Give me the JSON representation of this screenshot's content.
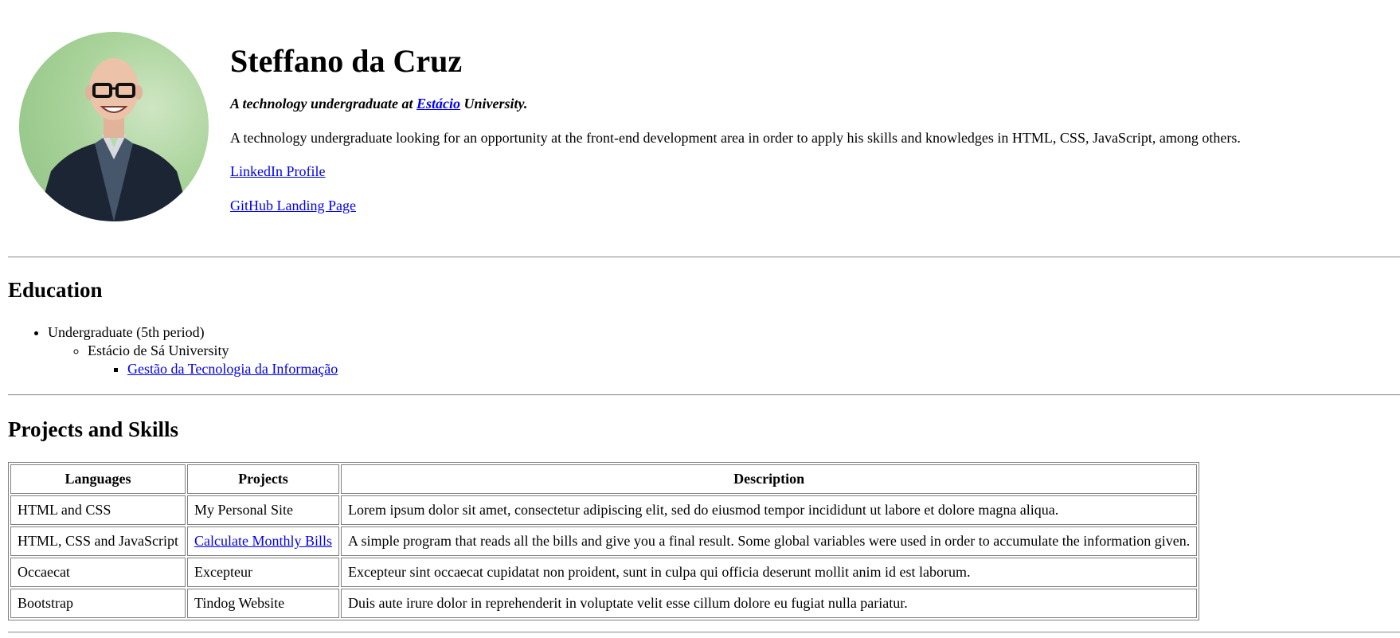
{
  "header": {
    "name": "Steffano da Cruz",
    "tagline_prefix": "A technology undergraduate at",
    "tagline_link": "Estácio",
    "tagline_suffix": "University.",
    "summary": "A technology undergraduate looking for an opportunity at the front-end development area in order to apply his skills and knowledges in HTML, CSS, JavaScript, among others.",
    "links": [
      {
        "label": "LinkedIn Profile"
      },
      {
        "label": "GitHub Landing Page"
      }
    ]
  },
  "education": {
    "title": "Education",
    "level": "Undergraduate (5th period)",
    "school": "Estácio de Sá University",
    "course": "Gestão da Tecnologia da Informação"
  },
  "projects": {
    "title": "Projects and Skills",
    "headers": [
      "Languages",
      "Projects",
      "Description"
    ],
    "rows": [
      {
        "language": "HTML and CSS",
        "project": "My Personal Site",
        "project_is_link": false,
        "description": "Lorem ipsum dolor sit amet, consectetur adipiscing elit, sed do eiusmod tempor incididunt ut labore et dolore magna aliqua."
      },
      {
        "language": "HTML, CSS and JavaScript",
        "project": "Calculate Monthly Bills",
        "project_is_link": true,
        "description": "A simple program that reads all the bills and give you a final result. Some global variables were used in order to accumulate the information given."
      },
      {
        "language": "Occaecat",
        "project": "Excepteur",
        "project_is_link": false,
        "description": "Excepteur sint occaecat cupidatat non proident, sunt in culpa qui officia deserunt mollit anim id est laborum."
      },
      {
        "language": "Bootstrap",
        "project": "Tindog Website",
        "project_is_link": false,
        "description": "Duis aute irure dolor in reprehenderit in voluptate velit esse cillum dolore eu fugiat nulla pariatur."
      }
    ]
  },
  "colors": {
    "link": "#0000ee",
    "profile_background": "#a9d39a",
    "rule": "#9a9a9a"
  }
}
